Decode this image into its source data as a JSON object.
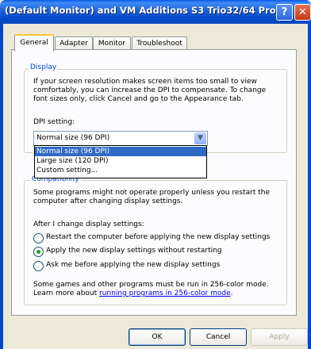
{
  "window": {
    "title": "(Default Monitor) and VM Additions S3 Trio32/64 Pro...",
    "help_label": "?",
    "close_label": "✕"
  },
  "tabs": [
    {
      "label": "General"
    },
    {
      "label": "Adapter"
    },
    {
      "label": "Monitor"
    },
    {
      "label": "Troubleshoot"
    }
  ],
  "display_group": {
    "title": "Display",
    "description_lines": [
      "If your screen resolution makes screen items too small to view",
      "comfortably, you can increase the DPI to compensate.  To change",
      "font sizes only, click Cancel and go to the Appearance tab."
    ],
    "dpi_label": "DPI setting:",
    "dpi_selected": "Normal size (96 DPI)",
    "dpi_options": [
      {
        "label": "Normal size (96 DPI)"
      },
      {
        "label": "Large size (120 DPI)"
      },
      {
        "label": "Custom setting..."
      }
    ]
  },
  "compat_group": {
    "title": "Compatibility",
    "description_lines": [
      "Some programs might not operate properly unless you restart the",
      "computer after changing display settings."
    ],
    "after_change_label": "After I change display settings:",
    "options": [
      {
        "label": "Restart the computer before applying the new display settings",
        "checked": false
      },
      {
        "label": "Apply the new display settings without restarting",
        "checked": true
      },
      {
        "label": "Ask me before applying the new display settings",
        "checked": false
      }
    ],
    "note_line1": "Some games and other programs must be run in 256-color mode.",
    "note_prefix": "Learn more about ",
    "note_link": "running programs in 256-color mode",
    "note_suffix": "."
  },
  "buttons": {
    "ok": "OK",
    "cancel": "Cancel",
    "apply": "Apply"
  }
}
